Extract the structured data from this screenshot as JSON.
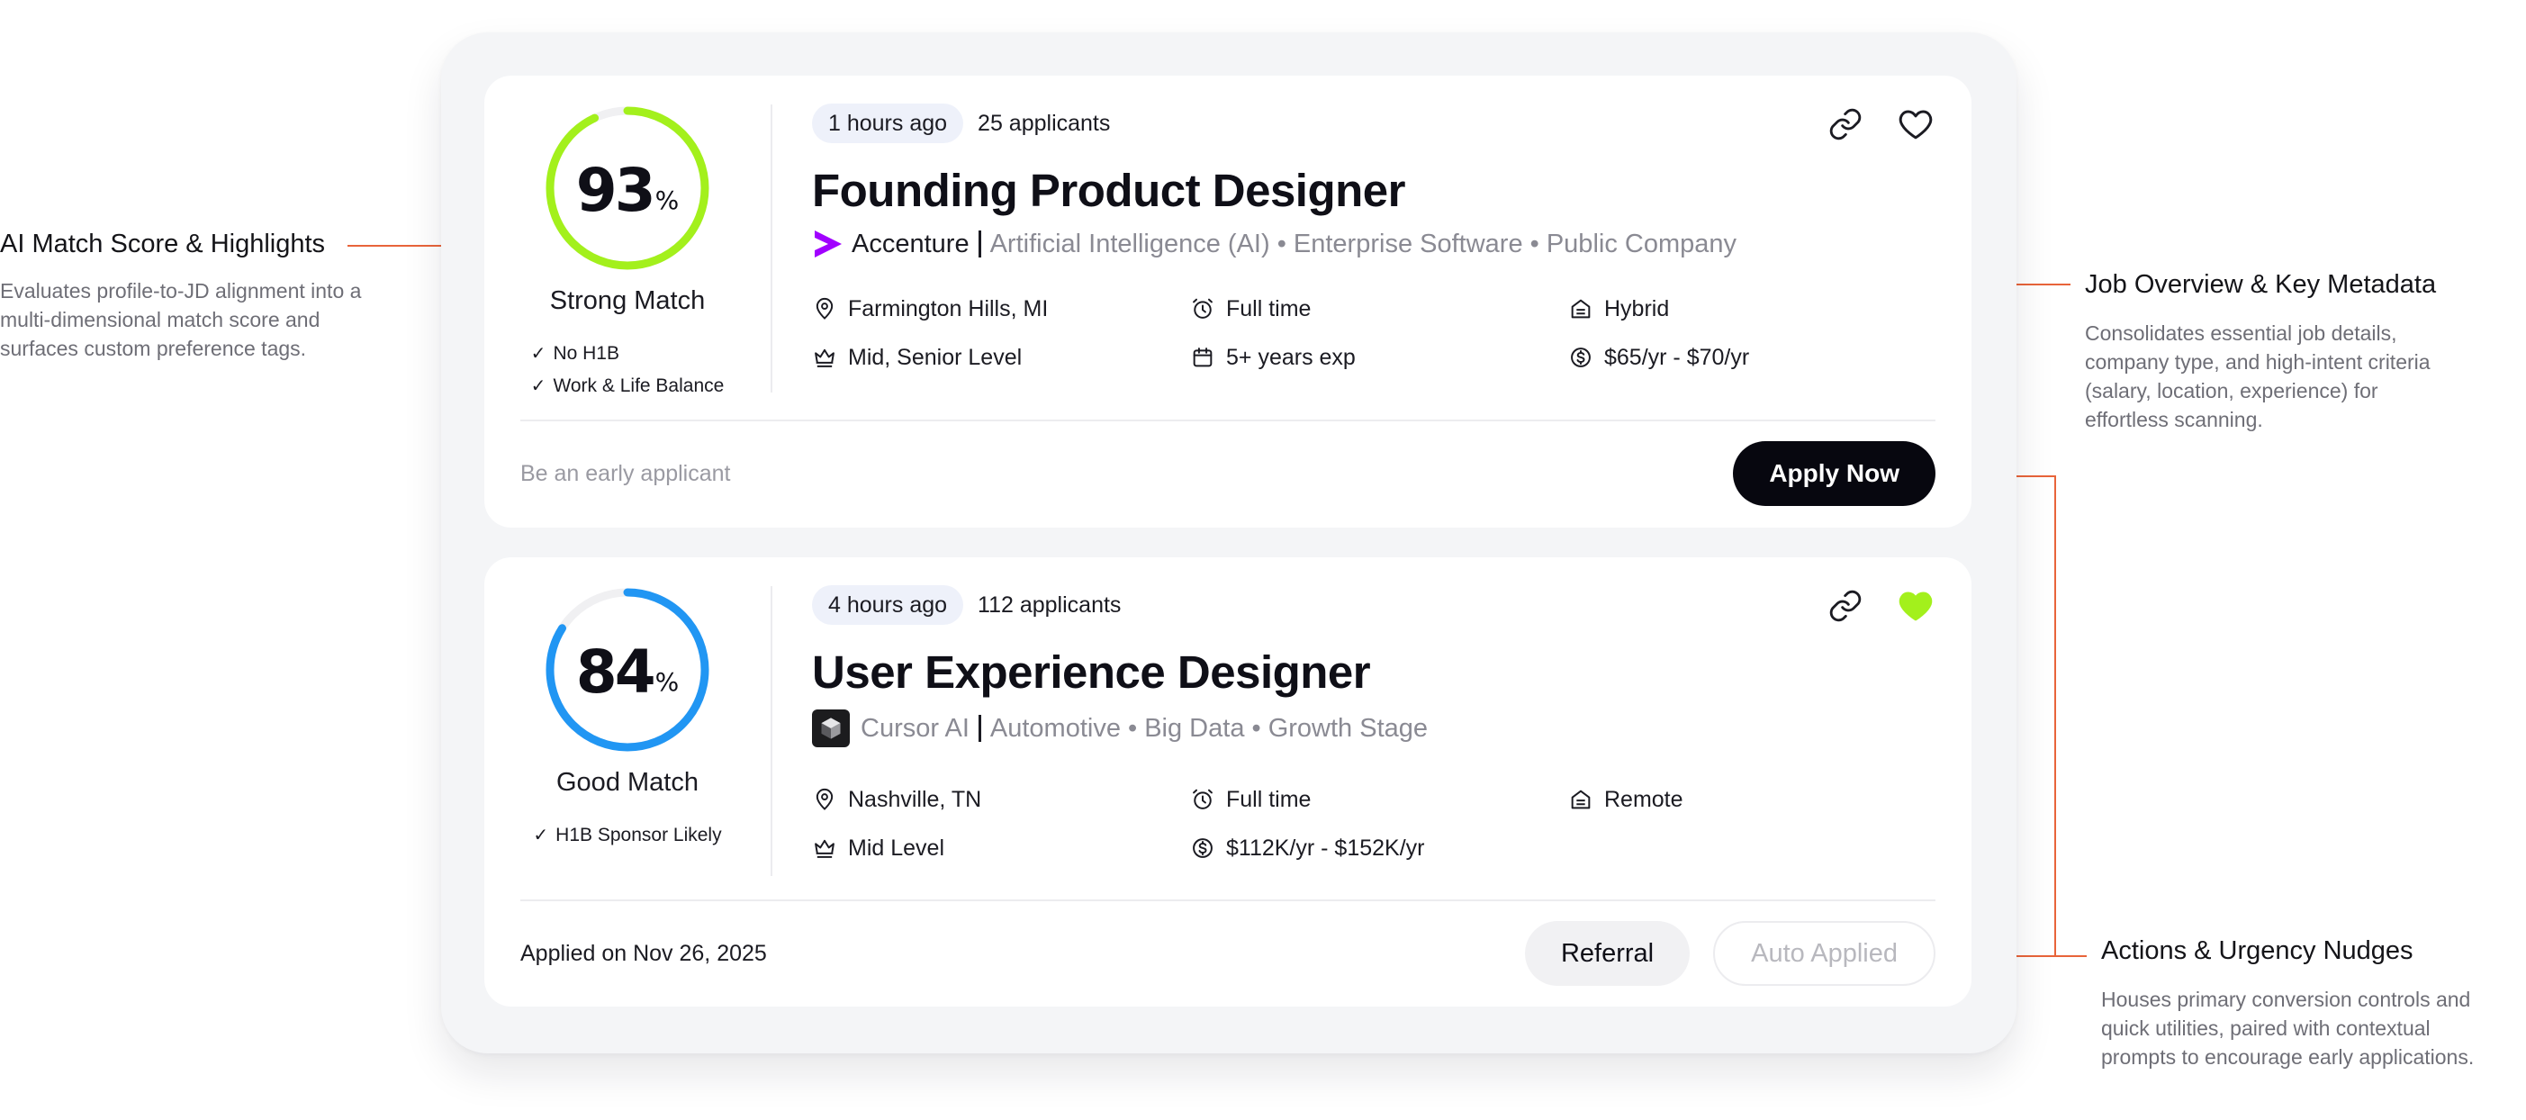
{
  "colors": {
    "accent_green": "#a3f01c",
    "accent_blue": "#2196f3",
    "annotation_orange": "#e8643a",
    "accenture_purple": "#a100ff"
  },
  "annotations": {
    "match": {
      "title": "AI Match Score & Highlights",
      "lines": [
        "Evaluates profile-to-JD alignment into a",
        "multi-dimensional match score and",
        "surfaces custom preference tags."
      ]
    },
    "overview": {
      "title": "Job Overview & Key Metadata",
      "lines": [
        "Consolidates essential job details,",
        "company type, and high-intent criteria",
        "(salary, location, experience) for",
        "effortless scanning."
      ]
    },
    "actions": {
      "title": "Actions & Urgency Nudges",
      "lines": [
        "Houses primary conversion controls and",
        "quick utilities, paired with contextual",
        "prompts to encourage early applications."
      ]
    }
  },
  "jobs": [
    {
      "score": "93",
      "score_value": 93,
      "percent_sign": "%",
      "match_label": "Strong Match",
      "tags": [
        "No H1B",
        "Work & Life Balance"
      ],
      "posted": "1 hours ago",
      "applicants": "25 applicants",
      "title": "Founding Product Designer",
      "company": "Accenture",
      "company_meta": "Artificial Intelligence (AI) • Enterprise Software • Public Company",
      "saved": false,
      "details": {
        "location": "Farmington Hills, MI",
        "type": "Full time",
        "workplace": "Hybrid",
        "level": "Mid, Senior Level",
        "experience": "5+ years exp",
        "salary": "$65/yr - $70/yr"
      },
      "footer_text": "Be an early applicant",
      "primary_button": "Apply Now"
    },
    {
      "score": "84",
      "score_value": 84,
      "percent_sign": "%",
      "match_label": "Good Match",
      "tags": [
        "H1B Sponsor Likely"
      ],
      "posted": "4 hours ago",
      "applicants": "112 applicants",
      "title": "User Experience Designer",
      "company": "Cursor AI",
      "company_meta": "Automotive • Big Data • Growth Stage",
      "saved": true,
      "details": {
        "location": "Nashville, TN",
        "type": "Full time",
        "workplace": "Remote",
        "level": "Mid Level",
        "salary": "$112K/yr - $152K/yr"
      },
      "footer_text": "Applied on Nov 26, 2025",
      "referral_button": "Referral",
      "auto_applied_button": "Auto Applied"
    }
  ]
}
